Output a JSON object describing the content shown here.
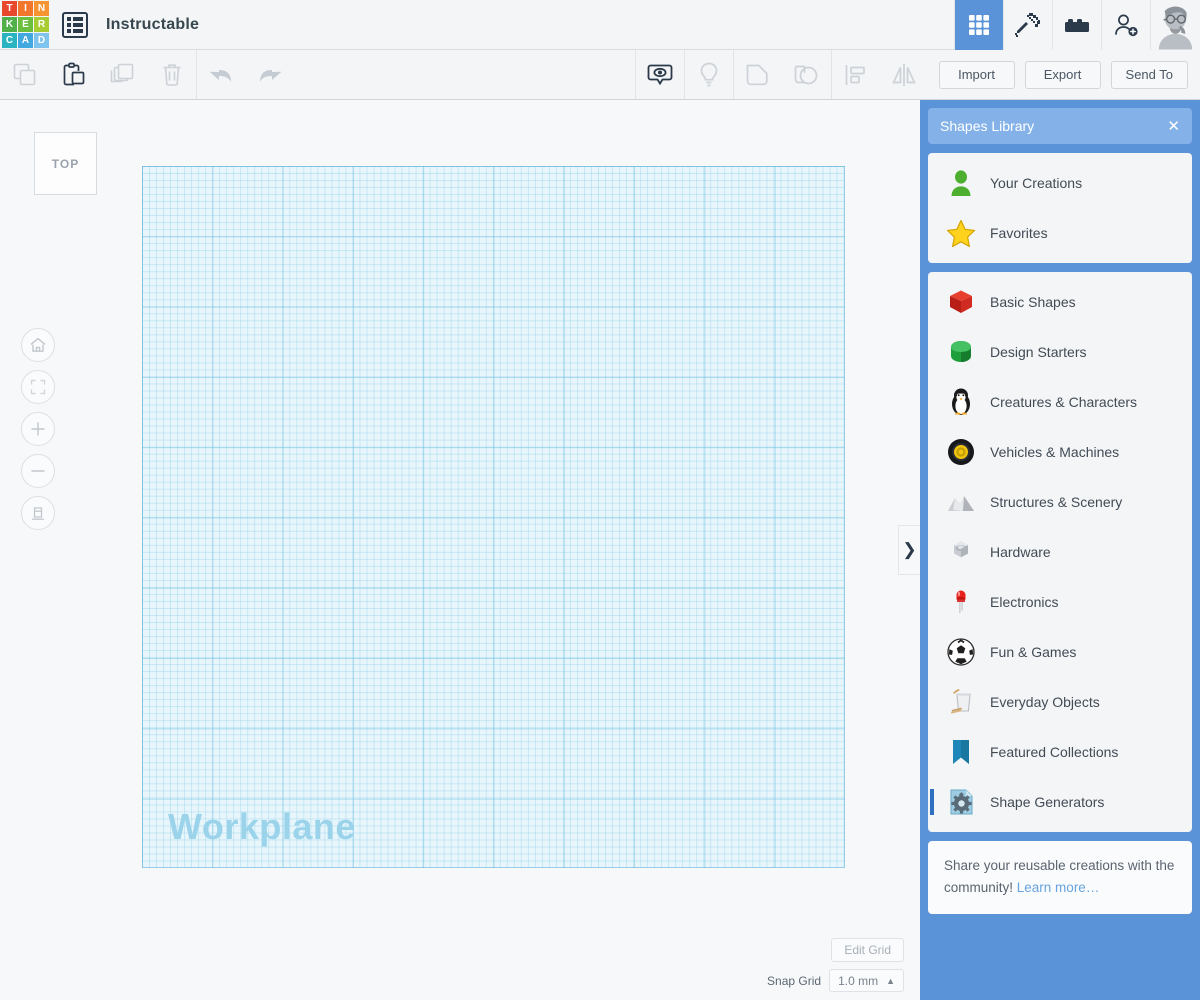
{
  "brand": {
    "logo_letters": [
      "T",
      "I",
      "N",
      "K",
      "E",
      "R",
      "C",
      "A",
      "D"
    ],
    "logo_colors": [
      "#e8482c",
      "#f2762b",
      "#f79432",
      "#52b04a",
      "#6cbf3e",
      "#a8cc34",
      "#2ab3c0",
      "#41a8e0",
      "#7fc4ec"
    ]
  },
  "topbar": {
    "menu_icon": "list-menu-icon",
    "doc_title": "Instructable",
    "right_buttons": [
      {
        "name": "grid-view-icon",
        "label": "Grid",
        "active": true
      },
      {
        "name": "minecraft-pickaxe-icon",
        "label": "Minecraft",
        "active": false
      },
      {
        "name": "lego-brick-icon",
        "label": "Blocks",
        "active": false
      },
      {
        "name": "add-person-icon",
        "label": "Invite",
        "active": false
      }
    ],
    "avatar": "user-avatar"
  },
  "toolbar": {
    "left_tools": [
      {
        "name": "copy-icon",
        "label": "Copy",
        "enabled": false
      },
      {
        "name": "paste-icon",
        "label": "Paste",
        "enabled": true
      },
      {
        "name": "duplicate-icon",
        "label": "Duplicate",
        "enabled": false
      },
      {
        "name": "delete-icon",
        "label": "Delete",
        "enabled": false
      },
      {
        "name": "undo-icon",
        "label": "Undo",
        "enabled": false
      },
      {
        "name": "redo-icon",
        "label": "Redo",
        "enabled": false
      }
    ],
    "right_tools": [
      {
        "name": "show-hide-icon",
        "label": "Show/Hide",
        "enabled": true
      },
      {
        "name": "lightbulb-note-icon",
        "label": "Note",
        "enabled": false
      },
      {
        "name": "group-icon",
        "label": "Group",
        "enabled": false
      },
      {
        "name": "ungroup-icon",
        "label": "Ungroup",
        "enabled": false
      },
      {
        "name": "align-icon",
        "label": "Align",
        "enabled": false
      },
      {
        "name": "mirror-icon",
        "label": "Mirror",
        "enabled": false
      }
    ],
    "import_label": "Import",
    "export_label": "Export",
    "sendto_label": "Send To"
  },
  "canvas": {
    "viewcube_face": "TOP",
    "nav_buttons": [
      {
        "name": "home-view-icon",
        "label": "Home View"
      },
      {
        "name": "fit-to-view-icon",
        "label": "Fit All In View"
      },
      {
        "name": "zoom-in-icon",
        "label": "Zoom In"
      },
      {
        "name": "zoom-out-icon",
        "label": "Zoom Out"
      },
      {
        "name": "ortho-perspective-icon",
        "label": "Switch To Orthographic"
      }
    ],
    "workplane_label": "Workplane",
    "edit_grid_label": "Edit Grid",
    "snap_grid_label": "Snap Grid",
    "snap_grid_value": "1.0 mm",
    "snap_grid_caret": "▲"
  },
  "panel": {
    "title": "Shapes Library",
    "close": "✕",
    "collapse_handle": "❯",
    "accent_color": "#5b93d9",
    "header_color": "#84b2e8",
    "group_a": [
      {
        "label": "Your Creations",
        "icon": "person-green-icon"
      },
      {
        "label": "Favorites",
        "icon": "star-yellow-icon"
      }
    ],
    "group_b": [
      {
        "label": "Basic Shapes",
        "icon": "red-cube-icon",
        "selected": false
      },
      {
        "label": "Design Starters",
        "icon": "green-cube-icon",
        "selected": false
      },
      {
        "label": "Creatures & Characters",
        "icon": "penguin-icon",
        "selected": false
      },
      {
        "label": "Vehicles & Machines",
        "icon": "wheel-icon",
        "selected": false
      },
      {
        "label": "Structures & Scenery",
        "icon": "rocks-icon",
        "selected": false
      },
      {
        "label": "Hardware",
        "icon": "hex-nut-icon",
        "selected": false
      },
      {
        "label": "Electronics",
        "icon": "led-icon",
        "selected": false
      },
      {
        "label": "Fun & Games",
        "icon": "soccer-ball-icon",
        "selected": false
      },
      {
        "label": "Everyday Objects",
        "icon": "trash-bin-icon",
        "selected": false
      },
      {
        "label": "Featured Collections",
        "icon": "bookmark-icon",
        "selected": false
      },
      {
        "label": "Shape Generators",
        "icon": "gear-page-icon",
        "selected": true
      }
    ],
    "share_text": "Share your reusable creations with the community! ",
    "share_link": "Learn more…"
  }
}
